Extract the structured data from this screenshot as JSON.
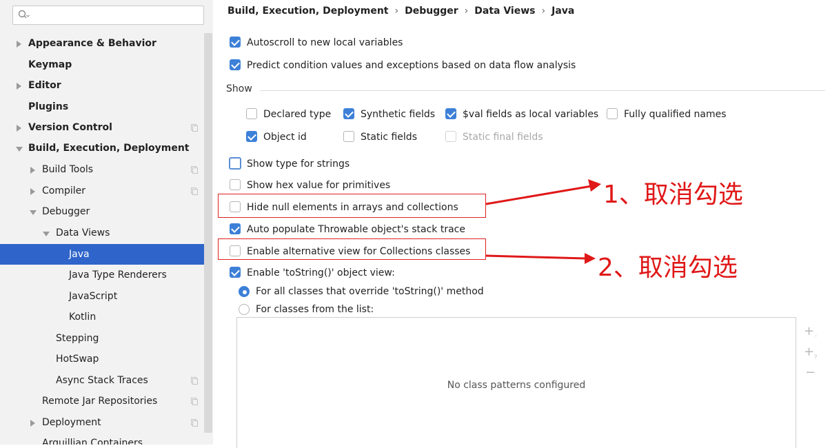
{
  "search": {
    "placeholder": ""
  },
  "sidebar": {
    "items": [
      {
        "label": "Appearance & Behavior"
      },
      {
        "label": "Keymap"
      },
      {
        "label": "Editor"
      },
      {
        "label": "Plugins"
      },
      {
        "label": "Version Control"
      },
      {
        "label": "Build, Execution, Deployment"
      },
      {
        "label": "Build Tools"
      },
      {
        "label": "Compiler"
      },
      {
        "label": "Debugger"
      },
      {
        "label": "Data Views"
      },
      {
        "label": "Java"
      },
      {
        "label": "Java Type Renderers"
      },
      {
        "label": "JavaScript"
      },
      {
        "label": "Kotlin"
      },
      {
        "label": "Stepping"
      },
      {
        "label": "HotSwap"
      },
      {
        "label": "Async Stack Traces"
      },
      {
        "label": "Remote Jar Repositories"
      },
      {
        "label": "Deployment"
      },
      {
        "label": "Arquillian Containers"
      }
    ]
  },
  "breadcrumb": [
    "Build, Execution, Deployment",
    "Debugger",
    "Data Views",
    "Java"
  ],
  "options": {
    "autoscroll": {
      "label": "Autoscroll to new local variables",
      "checked": true
    },
    "predict": {
      "label": "Predict condition values and exceptions based on data flow analysis",
      "checked": true
    },
    "show_section": "Show",
    "declared_type": {
      "label": "Declared type",
      "checked": false
    },
    "synthetic_fields": {
      "label": "Synthetic fields",
      "checked": true
    },
    "val_fields": {
      "label": "$val fields as local variables",
      "checked": true
    },
    "fully_qualified": {
      "label": "Fully qualified names",
      "checked": false
    },
    "object_id": {
      "label": "Object id",
      "checked": true
    },
    "static_fields": {
      "label": "Static fields",
      "checked": false
    },
    "static_final": {
      "label": "Static final fields",
      "checked": false
    },
    "type_strings": {
      "label": "Show type for strings",
      "checked": false
    },
    "hex_value": {
      "label": "Show hex value for primitives",
      "checked": false
    },
    "hide_null": {
      "label": "Hide null elements in arrays and collections",
      "checked": false
    },
    "auto_populate": {
      "label": "Auto populate Throwable object's stack trace",
      "checked": true
    },
    "alt_view": {
      "label": "Enable alternative view for Collections classes",
      "checked": false
    },
    "tostring_view": {
      "label": "Enable 'toString()' object view:",
      "checked": true
    },
    "radio_all": {
      "label": "For all classes that override 'toString()' method",
      "selected": true
    },
    "radio_list": {
      "label": "For classes from the list:",
      "selected": false
    }
  },
  "list_panel": {
    "empty_text": "No class patterns configured"
  },
  "annotations": [
    "1、取消勾选",
    "2、取消勾选"
  ],
  "colors": {
    "selection": "#2f65ca",
    "checkbox_on": "#3d80d8",
    "annotation_red": "#e01818"
  }
}
